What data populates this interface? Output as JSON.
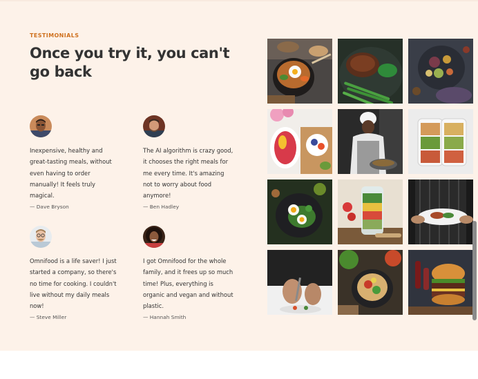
{
  "section": {
    "subheading": "TESTIMONIALS",
    "heading": "Once you try it, you can't go back"
  },
  "testimonials": [
    {
      "quote": "Inexpensive, healthy and great-tasting meals, without even having to order manually! It feels truly magical.",
      "name": "— Dave Bryson"
    },
    {
      "quote": "The AI algorithm is crazy good, it chooses the right meals for me every time. It's amazing not to worry about food anymore!",
      "name": "— Ben Hadley"
    },
    {
      "quote": "Omnifood is a life saver! I just started a company, so there's no time for cooking. I couldn't live without my daily meals now!",
      "name": "— Steve Miller"
    },
    {
      "quote": "I got Omnifood for the whole family, and it frees up so much time! Plus, everything is organic and vegan and without plastic.",
      "name": "— Hannah Smith"
    }
  ],
  "gallery_icons": [
    "bibimbap-bowl-photo",
    "steak-asparagus-photo",
    "grain-bowl-photo",
    "fruit-bowls-photo",
    "chef-cooking-photo",
    "meal-prep-containers-photo",
    "egg-salad-bowl-photo",
    "salad-jar-photo",
    "chef-serving-plate-photo",
    "chef-plating-photo",
    "vegetable-bowl-photo",
    "burger-photo"
  ],
  "colors": {
    "section_bg": "#fdf2e9",
    "accent": "#cf711f",
    "text": "#333333"
  }
}
